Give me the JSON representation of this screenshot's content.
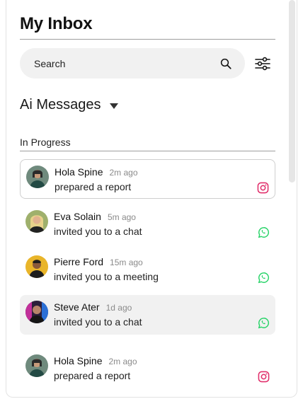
{
  "header": {
    "title": "My Inbox"
  },
  "search": {
    "placeholder": "Search"
  },
  "section": {
    "title": "Ai Messages"
  },
  "group": {
    "label": "In Progress"
  },
  "colors": {
    "instagram": "#e1306c",
    "whatsapp": "#25d366"
  },
  "messages": [
    {
      "name": "Hola Spine",
      "time": "2m ago",
      "action": "prepared a report",
      "channel": "instagram-icon"
    },
    {
      "name": "Eva Solain",
      "time": "5m ago",
      "action": "invited you to a chat",
      "channel": "whatsapp-icon"
    },
    {
      "name": "Pierre Ford",
      "time": "15m ago",
      "action": "invited you to a meeting",
      "channel": "whatsapp-icon"
    },
    {
      "name": "Steve Ater",
      "time": "1d ago",
      "action": "invited you to a chat",
      "channel": "whatsapp-icon"
    },
    {
      "name": "Hola Spine",
      "time": "2m ago",
      "action": "prepared a report",
      "channel": "instagram-icon"
    }
  ]
}
